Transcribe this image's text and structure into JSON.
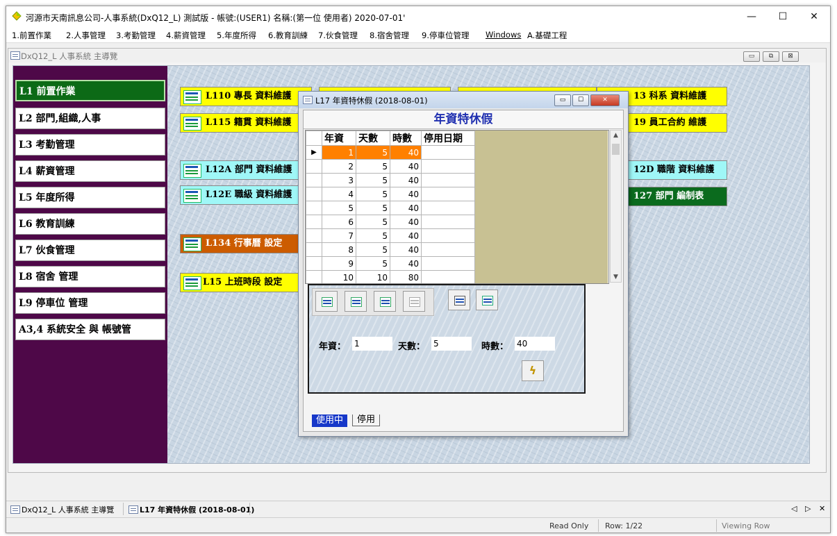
{
  "window": {
    "title": "河源市天南訊息公司-人事系統(DxQ12_L) 測試版 - 帳號:(USER1) 名稱:(第一位 使用者) 2020-07-01'",
    "controls": {
      "minimize": "—",
      "maximize": "☐",
      "close": "✕"
    }
  },
  "menu": [
    "1.前置作業",
    "2.人事管理",
    "3.考勤管理",
    "4.薪資管理",
    "5.年度所得",
    "6.教育訓練",
    "7.伙食管理",
    "8.宿舍管理",
    "9.停車位管理",
    "Windows",
    "A.基礎工程"
  ],
  "mdi": {
    "title": "DxQ12_L 人事系統 主導覽"
  },
  "nav": [
    "L1 前置作業",
    "L2 部門,組織,人事",
    "L3 考勤管理",
    "L4 薪資管理",
    "L5 年度所得",
    "L6 教育訓練",
    "L7 伙食管理",
    "L8 宿舍 管理",
    "L9 停車位 管理",
    "A3,4 系統安全 與 帳號管"
  ],
  "tiles": {
    "l110": "L110 專長 資料維護",
    "l115": "L115 籍貫 資料維護",
    "l12a": "L12A 部門 資料維護",
    "l12e": "L12E 職級 資料維護",
    "l134": "L134 行事曆 設定",
    "l15": "L15 上班時段 設定",
    "l13": "13 科系 資料維護",
    "l19": "19 員工合約 維護",
    "l12d": "12D 職階 資料維護",
    "l127": "127 部門 編制表"
  },
  "dialog": {
    "title": "L17 年資特休假 (2018-08-01)",
    "heading": "年資特休假",
    "columns": [
      "年資",
      "天數",
      "時數",
      "停用日期"
    ],
    "rows": [
      [
        "1",
        "5",
        "40",
        ""
      ],
      [
        "2",
        "5",
        "40",
        ""
      ],
      [
        "3",
        "5",
        "40",
        ""
      ],
      [
        "4",
        "5",
        "40",
        ""
      ],
      [
        "5",
        "5",
        "40",
        ""
      ],
      [
        "6",
        "5",
        "40",
        ""
      ],
      [
        "7",
        "5",
        "40",
        ""
      ],
      [
        "8",
        "5",
        "40",
        ""
      ],
      [
        "9",
        "5",
        "40",
        ""
      ],
      [
        "10",
        "10",
        "80",
        ""
      ]
    ],
    "selected_row": 1,
    "fields": {
      "seniority_label": "年資：",
      "seniority_value": "1",
      "days_label": "天數：",
      "days_value": "5",
      "hours_label": "時數：",
      "hours_value": "40"
    },
    "tabs": [
      "使用中",
      "停用"
    ]
  },
  "taskbar": {
    "item1": "DxQ12_L 人事系統 主導覽",
    "item2": "L17 年資特休假 (2018-08-01)",
    "nav_left": "◁",
    "nav_right": "▷",
    "close": "✕"
  },
  "status": {
    "read_only": "Read Only",
    "row": "Row: 1/22",
    "mode": "Viewing Row"
  },
  "colors": {
    "nav_bg": "#4e0848",
    "active_nav": "#0c6a16",
    "tile_yellow": "#ffff00",
    "tile_cyan": "#9ff7f7",
    "tile_orange": "#cc5c00",
    "tile_green": "#0b6b1e",
    "grid_selected": "#ff8000",
    "heading_text": "#1f2fb0"
  },
  "icons": [
    "app-diamond-icon",
    "window-doc-icon",
    "add-record-icon",
    "edit-record-icon",
    "save-record-icon",
    "delete-record-icon",
    "print-icon",
    "exit-icon",
    "lightning-icon"
  ]
}
